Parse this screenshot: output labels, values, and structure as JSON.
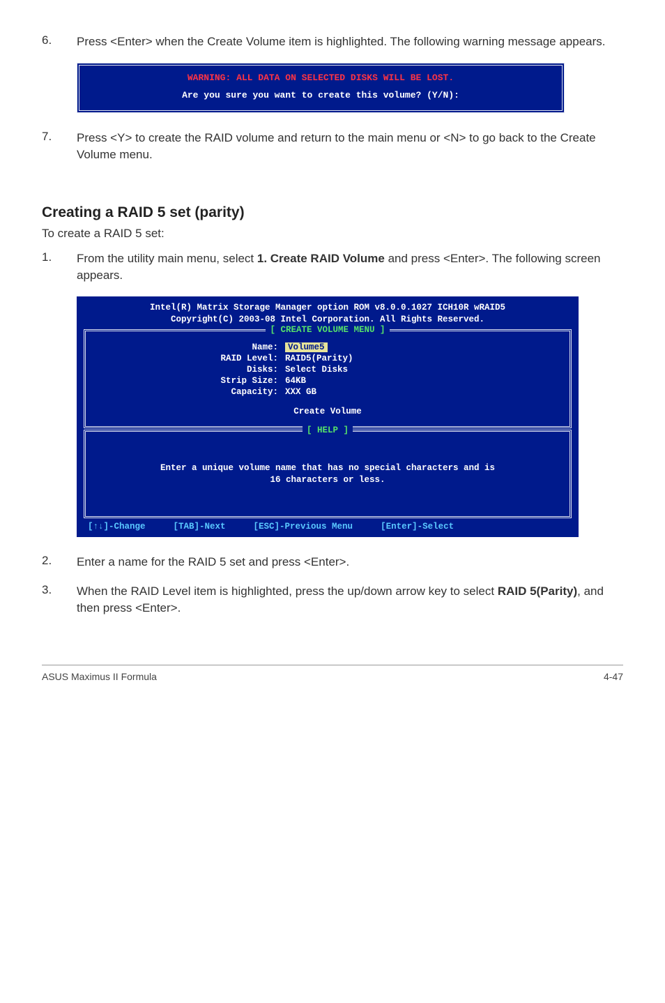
{
  "step6": {
    "num": "6.",
    "text": "Press <Enter> when the Create Volume item is highlighted. The following warning message appears."
  },
  "warn_box": {
    "warn": "WARNING: ALL DATA ON SELECTED DISKS WILL BE LOST.",
    "prompt": "Are you sure you want to create this volume? (Y/N):"
  },
  "step7": {
    "num": "7.",
    "text": "Press <Y> to create the RAID volume and return to the main menu or <N> to go back to the Create Volume menu."
  },
  "section_title": "Creating a RAID 5 set (parity)",
  "section_intro": "To create a RAID 5 set:",
  "step1": {
    "num": "1.",
    "pre": "From the utility main menu, select ",
    "bold": "1. Create RAID Volume",
    "post": " and press <Enter>. The following screen appears."
  },
  "bios": {
    "header1": "Intel(R) Matrix Storage Manager option ROM v8.0.0.1027 ICH10R wRAID5",
    "header2": "Copyright(C) 2003-08 Intel Corporation. All Rights Reserved.",
    "menu_title": "[ CREATE VOLUME MENU ]",
    "rows": {
      "name_l": "Name:",
      "name_v": "Volume5",
      "raid_l": "RAID Level:",
      "raid_v": "RAID5(Parity)",
      "disks_l": "Disks:",
      "disks_v": "Select Disks",
      "strip_l": "Strip Size:",
      "strip_v": "64KB",
      "cap_l": "Capacity:",
      "cap_v": "XXX   GB"
    },
    "create": "Create Volume",
    "help_title": "[ HELP ]",
    "help_line1": "Enter a unique volume name that has no special characters and is",
    "help_line2": "16 characters or less.",
    "footer": {
      "change": "[↑↓]-Change",
      "next": "[TAB]-Next",
      "prev": "[ESC]-Previous Menu",
      "select": "[Enter]-Select"
    }
  },
  "step2": {
    "num": "2.",
    "text": "Enter a name for the RAID 5 set and press <Enter>."
  },
  "step3": {
    "num": "3.",
    "pre": "When the RAID Level item is highlighted, press the up/down arrow key to select ",
    "bold": "RAID 5(Parity)",
    "post": ", and then press <Enter>."
  },
  "footer": {
    "left": "ASUS Maximus II Formula",
    "right": "4-47"
  }
}
